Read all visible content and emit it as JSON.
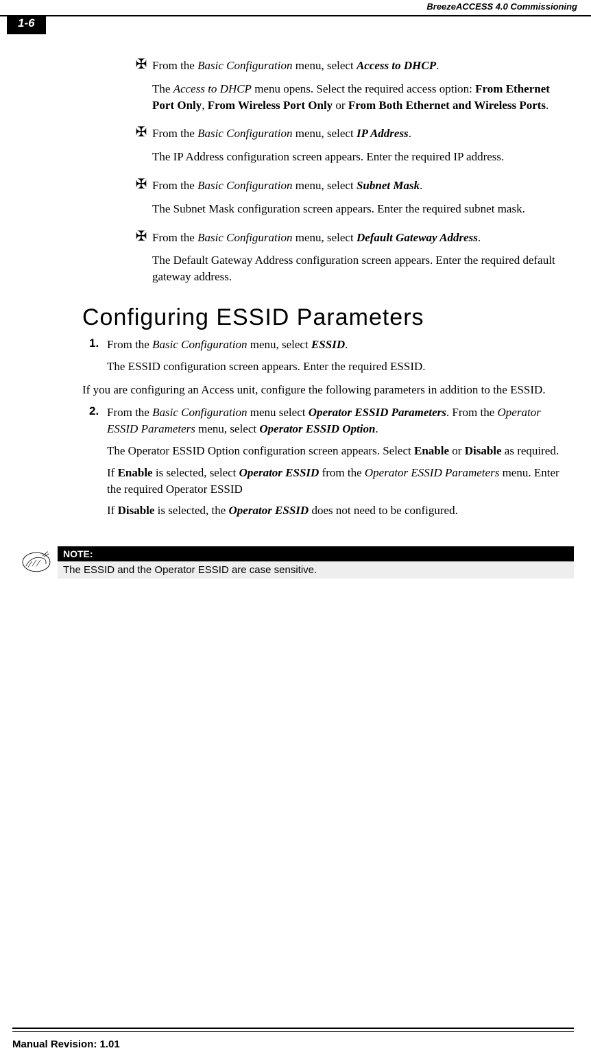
{
  "header": {
    "page_number": "1-6",
    "doc_title": "BreezeACCESS 4.0 Commissioning"
  },
  "bullets": [
    {
      "line": [
        {
          "t": "From the "
        },
        {
          "t": "Basic Configuration",
          "cls": "italic"
        },
        {
          "t": " menu, select "
        },
        {
          "t": "Access to DHCP",
          "cls": "bolditalic"
        },
        {
          "t": "."
        }
      ],
      "sub": [
        {
          "t": "The "
        },
        {
          "t": "Access to DHCP",
          "cls": "italic"
        },
        {
          "t": " menu opens. Select the required access option: "
        },
        {
          "t": "From Ethernet Port Only",
          "cls": "bold"
        },
        {
          "t": ", "
        },
        {
          "t": "From Wireless Port Only",
          "cls": "bold"
        },
        {
          "t": " or "
        },
        {
          "t": "From Both Ethernet and Wireless Ports",
          "cls": "bold"
        },
        {
          "t": "."
        }
      ]
    },
    {
      "line": [
        {
          "t": "From the "
        },
        {
          "t": "Basic Configuration",
          "cls": "italic"
        },
        {
          "t": " menu, select "
        },
        {
          "t": "IP Address",
          "cls": "bolditalic"
        },
        {
          "t": "."
        }
      ],
      "sub": [
        {
          "t": "The IP Address configuration screen appears. Enter the required IP address."
        }
      ]
    },
    {
      "line": [
        {
          "t": "From the "
        },
        {
          "t": "Basic Configuration",
          "cls": "italic"
        },
        {
          "t": " menu, select "
        },
        {
          "t": "Subnet Mask",
          "cls": "bolditalic"
        },
        {
          "t": "."
        }
      ],
      "sub": [
        {
          "t": "The Subnet Mask configuration screen appears. Enter the required subnet mask."
        }
      ]
    },
    {
      "line": [
        {
          "t": "From the "
        },
        {
          "t": "Basic Configuration",
          "cls": "italic"
        },
        {
          "t": " menu, select "
        },
        {
          "t": "Default Gateway Address",
          "cls": "bolditalic"
        },
        {
          "t": "."
        }
      ],
      "sub": [
        {
          "t": "The Default Gateway Address configuration screen appears. Enter the required default gateway address."
        }
      ]
    }
  ],
  "section_heading": "Configuring ESSID Parameters",
  "step1": {
    "num": "1.",
    "line": [
      {
        "t": "From the "
      },
      {
        "t": "Basic Configuration",
        "cls": "italic"
      },
      {
        "t": " menu, select "
      },
      {
        "t": "ESSID",
        "cls": "bolditalic"
      },
      {
        "t": "."
      }
    ],
    "sub": [
      {
        "t": "The ESSID configuration screen appears. Enter the required ESSID."
      }
    ]
  },
  "after_step1": "If you are configuring an Access unit, configure the following parameters in addition to the ESSID.",
  "step2": {
    "num": "2.",
    "line": [
      {
        "t": "From the "
      },
      {
        "t": "Basic Configuration",
        "cls": "italic"
      },
      {
        "t": " menu select "
      },
      {
        "t": "Operator ESSID Parameters",
        "cls": "bolditalic"
      },
      {
        "t": ". From the "
      },
      {
        "t": "Operator ESSID Parameters",
        "cls": "italic"
      },
      {
        "t": " menu, select "
      },
      {
        "t": "Operator ESSID Option",
        "cls": "bolditalic"
      },
      {
        "t": "."
      }
    ],
    "subs": [
      [
        {
          "t": "The Operator ESSID Option configuration screen appears. Select "
        },
        {
          "t": "Enable",
          "cls": "bold"
        },
        {
          "t": " or "
        },
        {
          "t": "Disable",
          "cls": "bold"
        },
        {
          "t": " as required."
        }
      ],
      [
        {
          "t": "If "
        },
        {
          "t": "Enable",
          "cls": "bold"
        },
        {
          "t": " is selected, select "
        },
        {
          "t": "Operator ESSID",
          "cls": "bolditalic"
        },
        {
          "t": " from the "
        },
        {
          "t": "Operator ESSID Parameters",
          "cls": "italic"
        },
        {
          "t": " menu. Enter the required Operator ESSID"
        }
      ],
      [
        {
          "t": "If "
        },
        {
          "t": "Disable",
          "cls": "bold"
        },
        {
          "t": " is selected, the "
        },
        {
          "t": "Operator ESSID",
          "cls": "bolditalic"
        },
        {
          "t": " does not need to be configured."
        }
      ]
    ]
  },
  "note": {
    "head": "NOTE:",
    "text": "The ESSID and the Operator ESSID are case sensitive."
  },
  "footer": "Manual Revision: 1.01"
}
